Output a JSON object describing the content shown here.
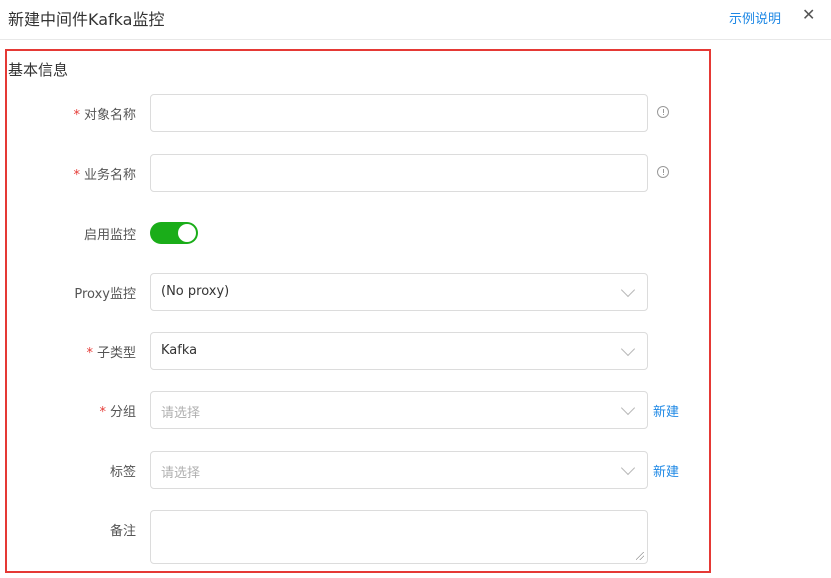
{
  "header": {
    "title": "新建中间件Kafka监控",
    "help_link": "示例说明",
    "close_glyph": "✕"
  },
  "section": {
    "title": "基本信息"
  },
  "form": {
    "required_mark": "*",
    "object_name": {
      "label": "对象名称",
      "value": ""
    },
    "business_name": {
      "label": "业务名称",
      "value": ""
    },
    "enable_monitor": {
      "label": "启用监控",
      "enabled": true
    },
    "proxy": {
      "label": "Proxy监控",
      "value": "(No proxy)"
    },
    "subtype": {
      "label": "子类型",
      "value": "Kafka"
    },
    "group": {
      "label": "分组",
      "placeholder": "请选择",
      "new_link": "新建"
    },
    "tags": {
      "label": "标签",
      "placeholder": "请选择",
      "new_link": "新建"
    },
    "remark": {
      "label": "备注",
      "value": ""
    }
  },
  "colors": {
    "accent": "#1e88e5",
    "toggle_on": "#1aad19",
    "required": "#e53935",
    "highlight_border": "#e53935"
  }
}
